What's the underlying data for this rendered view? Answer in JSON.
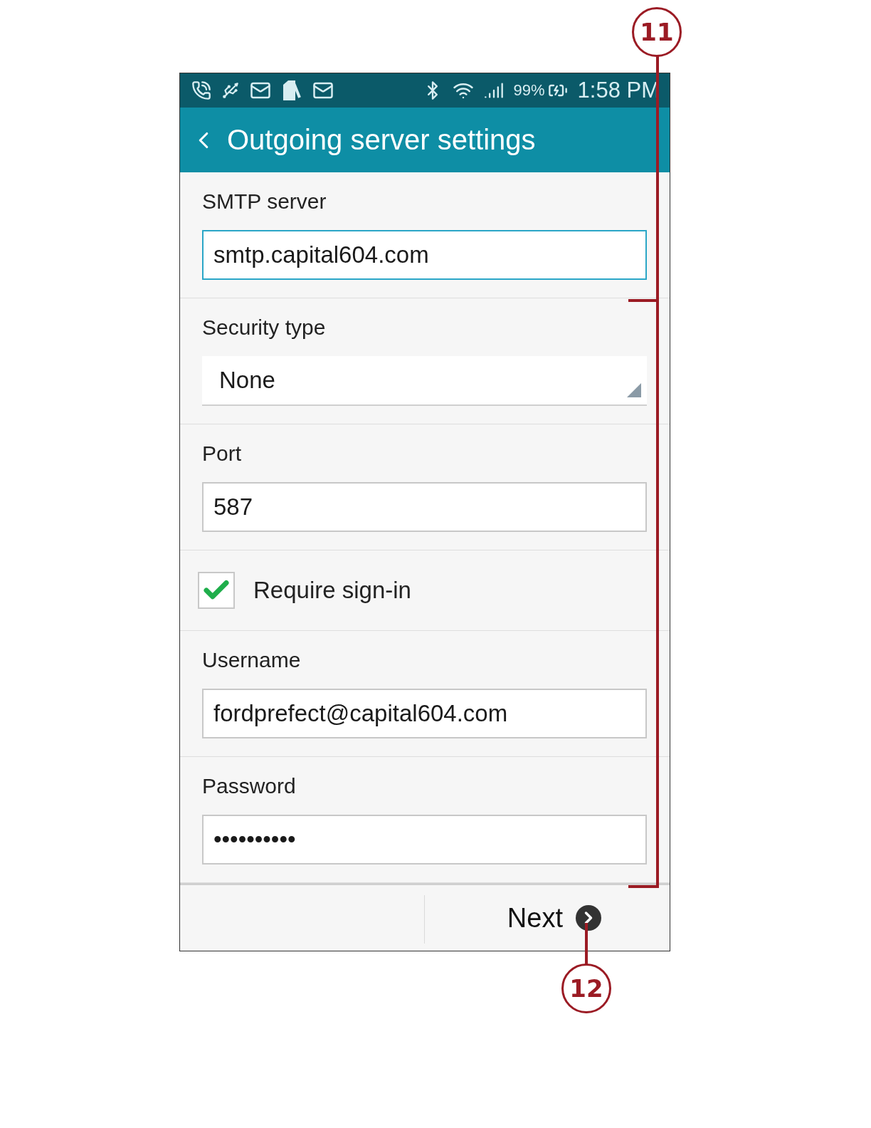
{
  "status_bar": {
    "battery": "99%",
    "time": "1:58 PM"
  },
  "header": {
    "title": "Outgoing server settings"
  },
  "fields": [
    {
      "kind": "text",
      "label": "SMTP server",
      "value": "smtp.capital604.com",
      "focused": true
    },
    {
      "kind": "dropdown",
      "label": "Security type",
      "value": "None"
    },
    {
      "kind": "text",
      "label": "Port",
      "value": "587",
      "focused": false
    },
    {
      "kind": "checkbox",
      "label": "Require sign-in",
      "checked": true
    },
    {
      "kind": "text",
      "label": "Username",
      "value": "fordprefect@capital604.com",
      "focused": false
    },
    {
      "kind": "text",
      "label": "Password",
      "value": "••••••••••",
      "focused": false
    }
  ],
  "footer": {
    "next": "Next"
  },
  "callouts": [
    {
      "number": "11"
    },
    {
      "number": "12"
    }
  ]
}
